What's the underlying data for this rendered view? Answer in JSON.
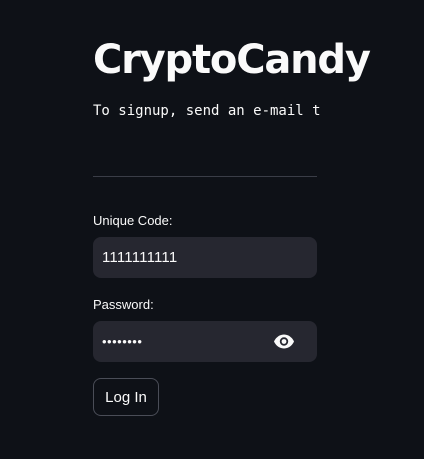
{
  "app": {
    "title": "CryptoCandy",
    "signup_text": "To signup, send an e-mail t"
  },
  "form": {
    "unique_code": {
      "label": "Unique Code:",
      "value": "1111111111"
    },
    "password": {
      "label": "Password:",
      "masked_value": "••••••••",
      "toggle_icon": "eye-icon"
    },
    "login_label": "Log In"
  },
  "colors": {
    "background": "#0e1117",
    "input_background": "#262730",
    "text": "#fafafa",
    "divider": "#3a3d47"
  }
}
